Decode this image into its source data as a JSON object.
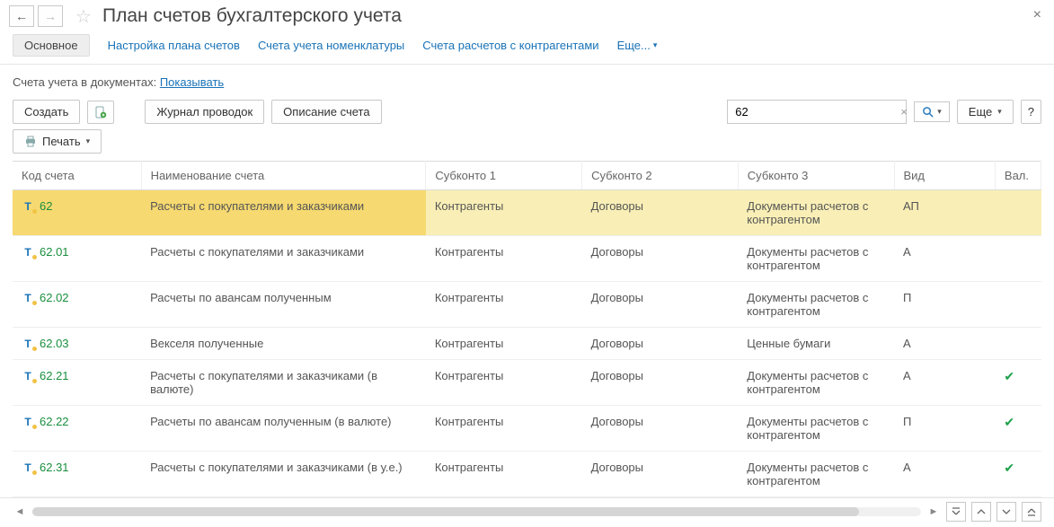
{
  "header": {
    "title": "План счетов бухгалтерского учета"
  },
  "tabs": {
    "main": "Основное",
    "link1": "Настройка плана счетов",
    "link2": "Счета учета номенклатуры",
    "link3": "Счета расчетов с контрагентами",
    "more": "Еще..."
  },
  "infoline": {
    "label": "Счета учета в документах:",
    "value": "Показывать"
  },
  "toolbar": {
    "create": "Создать",
    "journal": "Журнал проводок",
    "describe": "Описание счета",
    "search_value": "62",
    "more": "Еще",
    "help": "?",
    "print": "Печать"
  },
  "columns": {
    "code": "Код счета",
    "name": "Наименование счета",
    "sub1": "Субконто 1",
    "sub2": "Субконто 2",
    "sub3": "Субконто 3",
    "type": "Вид",
    "val": "Вал."
  },
  "rows": [
    {
      "code": "62",
      "name": "Расчеты с покупателями и заказчиками",
      "sub1": "Контрагенты",
      "sub2": "Договоры",
      "sub3": "Документы расчетов с контрагентом",
      "type": "АП",
      "val": false,
      "selected": true
    },
    {
      "code": "62.01",
      "name": "Расчеты с покупателями и заказчиками",
      "sub1": "Контрагенты",
      "sub2": "Договоры",
      "sub3": "Документы расчетов с контрагентом",
      "type": "А",
      "val": false,
      "selected": false
    },
    {
      "code": "62.02",
      "name": "Расчеты по авансам полученным",
      "sub1": "Контрагенты",
      "sub2": "Договоры",
      "sub3": "Документы расчетов с контрагентом",
      "type": "П",
      "val": false,
      "selected": false
    },
    {
      "code": "62.03",
      "name": "Векселя полученные",
      "sub1": "Контрагенты",
      "sub2": "Договоры",
      "sub3": "Ценные бумаги",
      "type": "А",
      "val": false,
      "selected": false
    },
    {
      "code": "62.21",
      "name": "Расчеты с покупателями и заказчиками (в валюте)",
      "sub1": "Контрагенты",
      "sub2": "Договоры",
      "sub3": "Документы расчетов с контрагентом",
      "type": "А",
      "val": true,
      "selected": false
    },
    {
      "code": "62.22",
      "name": "Расчеты по авансам полученным (в валюте)",
      "sub1": "Контрагенты",
      "sub2": "Договоры",
      "sub3": "Документы расчетов с контрагентом",
      "type": "П",
      "val": true,
      "selected": false
    },
    {
      "code": "62.31",
      "name": "Расчеты с покупателями и заказчиками (в у.е.)",
      "sub1": "Контрагенты",
      "sub2": "Договоры",
      "sub3": "Документы расчетов с контрагентом",
      "type": "А",
      "val": true,
      "selected": false
    }
  ]
}
